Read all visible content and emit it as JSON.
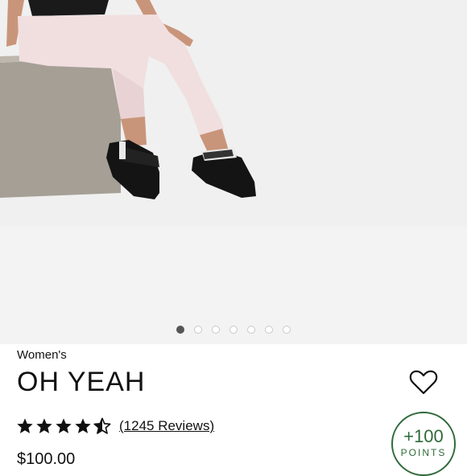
{
  "product": {
    "gender": "Women's",
    "name": "OH YEAH",
    "rating": 4.5,
    "reviews_label": "(1245 Reviews)",
    "price": "$100.00"
  },
  "gallery": {
    "image_count": 7,
    "active_index": 0
  },
  "rewards": {
    "points_value": "+100",
    "points_label": "POINTS"
  },
  "colors": {
    "accent_green": "#2f6a3b",
    "hero_background": "#f3f3f3",
    "active_dot": "#555555"
  },
  "icons": {
    "favorite": "heart-outline-icon",
    "rating_full": "star-icon",
    "rating_half": "star-half-icon"
  }
}
